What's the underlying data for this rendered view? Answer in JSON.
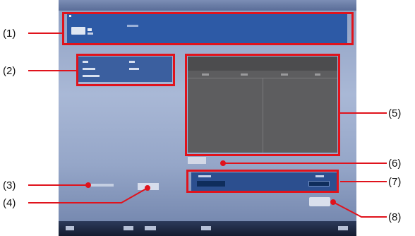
{
  "callouts": [
    "(1)",
    "(2)",
    "(3)",
    "(4)",
    "(5)",
    "(6)",
    "(7)",
    "(8)"
  ],
  "colors": {
    "callout_frame": "#e0131c",
    "header_blue": "#2d5aa6",
    "preview_gray": "#5d5d5f",
    "info_blue": "#3b5f9f"
  }
}
